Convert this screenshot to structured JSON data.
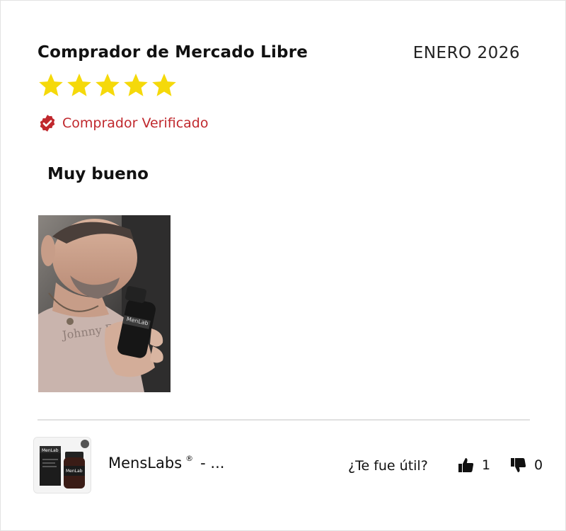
{
  "review": {
    "reviewer": "Comprador de Mercado Libre",
    "date": "ENERO 2026",
    "rating": 5,
    "rating_max": 5,
    "star_color": "#f5d90a",
    "verified_label": "Comprador Verificado",
    "verified_color": "#c0282d",
    "title": "Muy bueno"
  },
  "footer": {
    "product_name": "MensLabs",
    "registered_mark": "®",
    "product_suffix": "- ...",
    "helpful_question": "¿Te fue útil?",
    "likes": "1",
    "dislikes": "0"
  },
  "thumb": {
    "brand": "MenLab"
  },
  "photo": {
    "shirt_text": "Johnny Bro"
  }
}
